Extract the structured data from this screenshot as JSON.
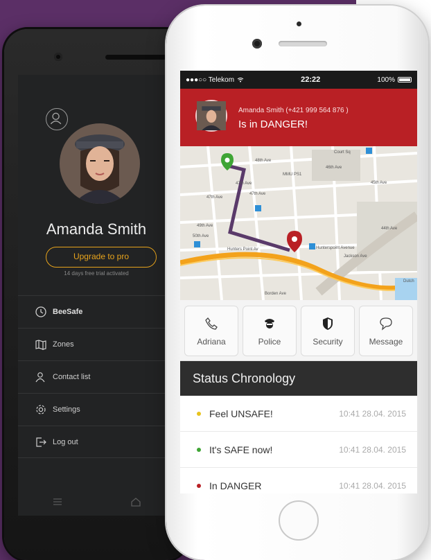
{
  "android": {
    "profile": {
      "name": "Amanda Smith",
      "upgrade_label": "Upgrade to pro",
      "trial_note": "14 days free trial activated"
    },
    "menu": [
      {
        "label": "BeeSafe",
        "icon": "clock-icon"
      },
      {
        "label": "Zones",
        "icon": "map-icon"
      },
      {
        "label": "Contact list",
        "icon": "contacts-icon"
      },
      {
        "label": "Settings",
        "icon": "gear-icon"
      },
      {
        "label": "Log out",
        "icon": "logout-icon"
      }
    ]
  },
  "ios": {
    "status_bar": {
      "carrier": "●●●○○ Telekom",
      "time": "22:22",
      "battery": "100%"
    },
    "alert": {
      "contact": "Amanda Smith (+421 999 564 876 )",
      "status": "Is in DANGER!"
    },
    "map": {
      "labels": [
        "48th Ave",
        "47th Ave",
        "47th Ave",
        "49th Ave",
        "50th Ave",
        "47th Ave",
        "MMU PS1",
        "Court Sq",
        "46th Ave",
        "45th Ave",
        "44th Ave",
        "Hunters Point Av",
        "Hunterspoint Avenue",
        "Borden Ave",
        "Jackson Ave",
        "Dutch"
      ]
    },
    "actions": [
      {
        "label": "Adriana",
        "icon": "phone-icon"
      },
      {
        "label": "Police",
        "icon": "police-icon"
      },
      {
        "label": "Security",
        "icon": "shield-icon"
      },
      {
        "label": "Message",
        "icon": "chat-icon"
      }
    ],
    "chronology": {
      "title": "Status Chronology",
      "items": [
        {
          "label": "Feel UNSAFE!",
          "time": "10:41 28.04. 2015",
          "color": "#e8c31d"
        },
        {
          "label": "It's SAFE now!",
          "time": "10:41 28.04. 2015",
          "color": "#3fa535"
        },
        {
          "label": "In DANGER",
          "time": "10:41 28.04. 2015",
          "color": "#b92025"
        }
      ]
    }
  },
  "colors": {
    "background": "#5b2f66",
    "danger": "#b92025",
    "accent_orange": "#e8a41c",
    "route": "#5a3a6a"
  }
}
